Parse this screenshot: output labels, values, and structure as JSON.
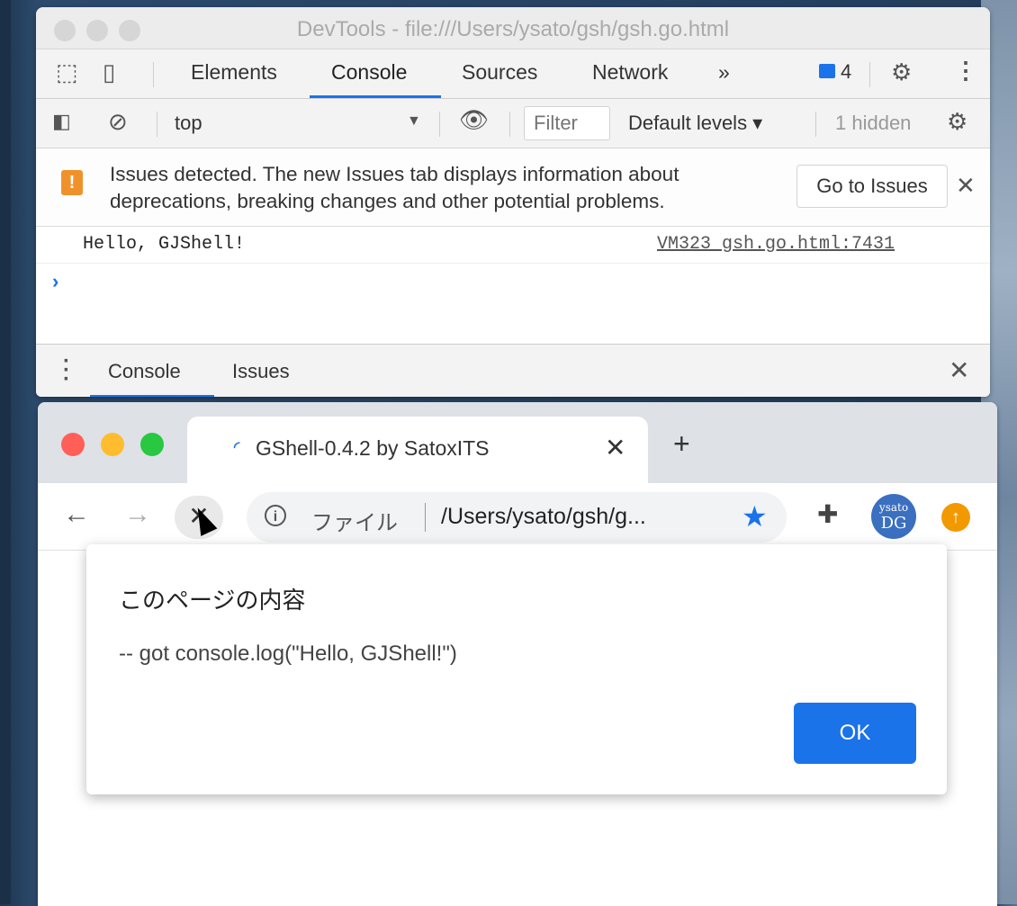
{
  "devtools": {
    "window_title": "DevTools - file:///Users/ysato/gsh/gsh.go.html",
    "tabs": [
      "Elements",
      "Console",
      "Sources",
      "Network",
      "»"
    ],
    "active_tab": "Console",
    "message_count": "4",
    "toolbar": {
      "context": "top",
      "filter_placeholder": "Filter",
      "levels_label": "Default levels ▾",
      "hidden_label": "1 hidden"
    },
    "issues_banner": {
      "text": "Issues detected. The new Issues tab displays information about deprecations, breaking changes and other potential problems.",
      "button": "Go to Issues"
    },
    "console": {
      "log_text": "Hello, GJShell!",
      "log_source": "VM323 gsh.go.html:7431",
      "prompt": "›"
    },
    "drawer": {
      "tabs": [
        "Console",
        "Issues"
      ],
      "active_tab": "Console"
    }
  },
  "browser": {
    "tab_title": "GShell-0.4.2 by SatoxITS",
    "address": {
      "scheme_label": "ファイル",
      "url": "/Users/ysato/gsh/g..."
    },
    "avatar": {
      "line1": "ysato",
      "line2": "DG"
    },
    "traffic_colors": [
      "#ff5f57",
      "#febc2e",
      "#28c840"
    ],
    "accent": "#1a73e8",
    "dialog": {
      "title": "このページの内容",
      "message": "-- got console.log(\"Hello, GJShell!\")",
      "ok_label": "OK"
    }
  }
}
